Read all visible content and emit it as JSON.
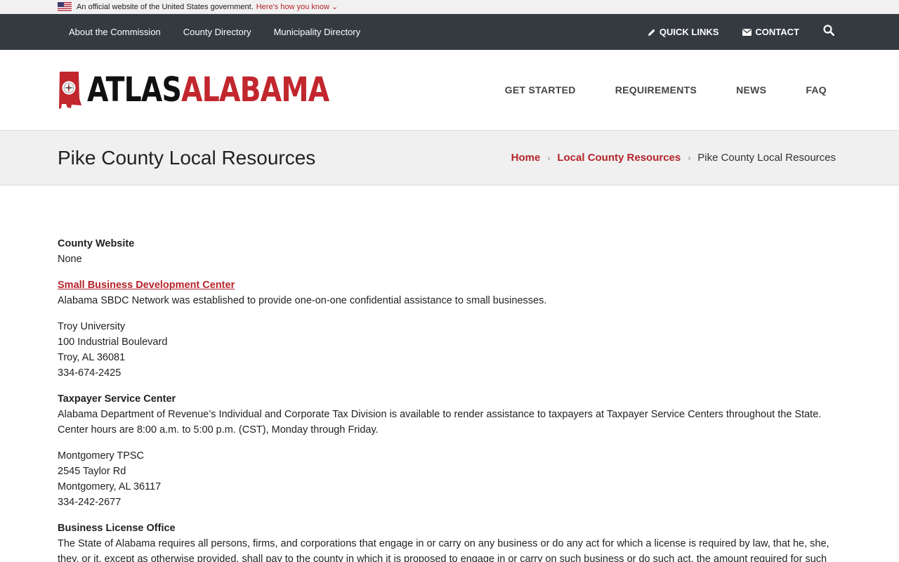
{
  "gov_banner": {
    "text": "An official website of the United States government.",
    "link": "Here’s how you know"
  },
  "topbar": {
    "links": [
      "About the Commission",
      "County Directory",
      "Municipality Directory"
    ],
    "quick_links": "QUICK LINKS",
    "contact": "CONTACT"
  },
  "logo": {
    "part1": "ATLAS",
    "part2": "ALABAMA"
  },
  "main_nav": [
    "GET STARTED",
    "REQUIREMENTS",
    "NEWS",
    "FAQ"
  ],
  "page": {
    "title": "Pike County Local Resources",
    "breadcrumb": {
      "home": "Home",
      "parent": "Local County Resources",
      "current": "Pike County Local Resources"
    }
  },
  "content": {
    "county_website": {
      "heading": "County Website",
      "value": "None"
    },
    "sbdc": {
      "link": "Small Business Development Center",
      "desc": "Alabama SBDC Network was established to provide one-on-one confidential assistance to small businesses.",
      "address": [
        "Troy University",
        "100 Industrial Boulevard",
        "Troy, AL 36081",
        "334-674-2425"
      ]
    },
    "taxpayer": {
      "heading": "Taxpayer Service Center",
      "desc": "Alabama Department of Revenue’s Individual and Corporate Tax Division is available to render assistance to taxpayers at Taxpayer Service Centers throughout the State. Center hours are 8:00 a.m. to 5:00 p.m. (CST), Monday through Friday.",
      "address": [
        "Montgomery TPSC",
        "2545 Taylor Rd",
        "Montgomery, AL 36117",
        "334-242-2677"
      ]
    },
    "license": {
      "heading": "Business License Office",
      "desc": "The State of Alabama requires all persons, firms, and corporations that engage in or carry on any business or do any act for which a license is required by law, that he, she, they, or it, except as otherwise provided, shall pay to the county in which it is proposed to engage in or carry on such business or do such act, the amount required for such license and shall"
    }
  },
  "colors": {
    "accent": "#b5242a",
    "topbar": "#343a40",
    "titlebar": "#f0f0f0"
  },
  "icons": {
    "quick_links": "pencil-icon",
    "contact": "envelope-icon",
    "search": "search-icon",
    "flag": "us-flag-icon",
    "chevron": "chevron-down-icon"
  }
}
